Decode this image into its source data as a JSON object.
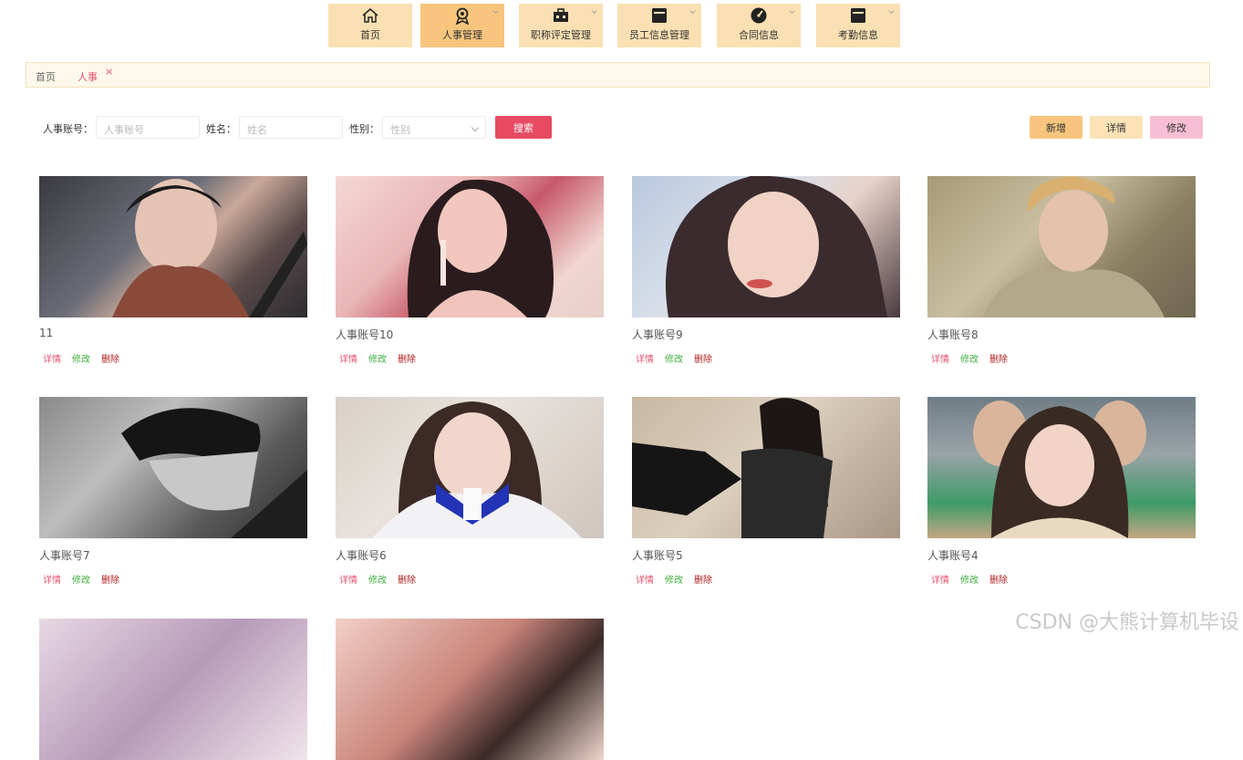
{
  "nav": {
    "items": [
      {
        "label": "首页",
        "icon": "home-icon",
        "caret": false
      },
      {
        "label": "人事管理",
        "icon": "badge-icon",
        "caret": true
      },
      {
        "label": "职称评定管理",
        "icon": "briefcase-icon",
        "caret": true
      },
      {
        "label": "员工信息管理",
        "icon": "card-icon",
        "caret": true
      },
      {
        "label": "合同信息",
        "icon": "gauge-icon",
        "caret": true
      },
      {
        "label": "考勤信息",
        "icon": "card-icon",
        "caret": true
      }
    ]
  },
  "breadcrumb": {
    "home": "首页",
    "current": "人事",
    "close": "×"
  },
  "search": {
    "account_label": "人事账号：",
    "account_placeholder": "人事账号",
    "name_label": "姓名：",
    "name_placeholder": "姓名",
    "gender_label": "性别：",
    "gender_placeholder": "性别",
    "search_btn": "搜索"
  },
  "toolbar": {
    "add": "新增",
    "detail": "详情",
    "edit": "修改"
  },
  "cards": [
    {
      "title": "11",
      "photo": "person-photo"
    },
    {
      "title": "人事账号10",
      "photo": "person-photo"
    },
    {
      "title": "人事账号9",
      "photo": "person-photo"
    },
    {
      "title": "人事账号8",
      "photo": "person-photo"
    },
    {
      "title": "人事账号7",
      "photo": "person-photo"
    },
    {
      "title": "人事账号6",
      "photo": "person-photo"
    },
    {
      "title": "人事账号5",
      "photo": "person-photo"
    },
    {
      "title": "人事账号4",
      "photo": "person-photo"
    },
    {
      "title": "",
      "photo": "person-photo"
    },
    {
      "title": "",
      "photo": "person-photo"
    }
  ],
  "card_actions": {
    "detail": "详情",
    "edit": "修改",
    "delete": "删除"
  },
  "watermark": "CSDN @大熊计算机毕设",
  "colors": {
    "nav": "#fae0b3",
    "nav_active": "#f7c57d",
    "accent": "#e84a62",
    "edit_green": "#3fae3f",
    "delete_red": "#b02020"
  }
}
